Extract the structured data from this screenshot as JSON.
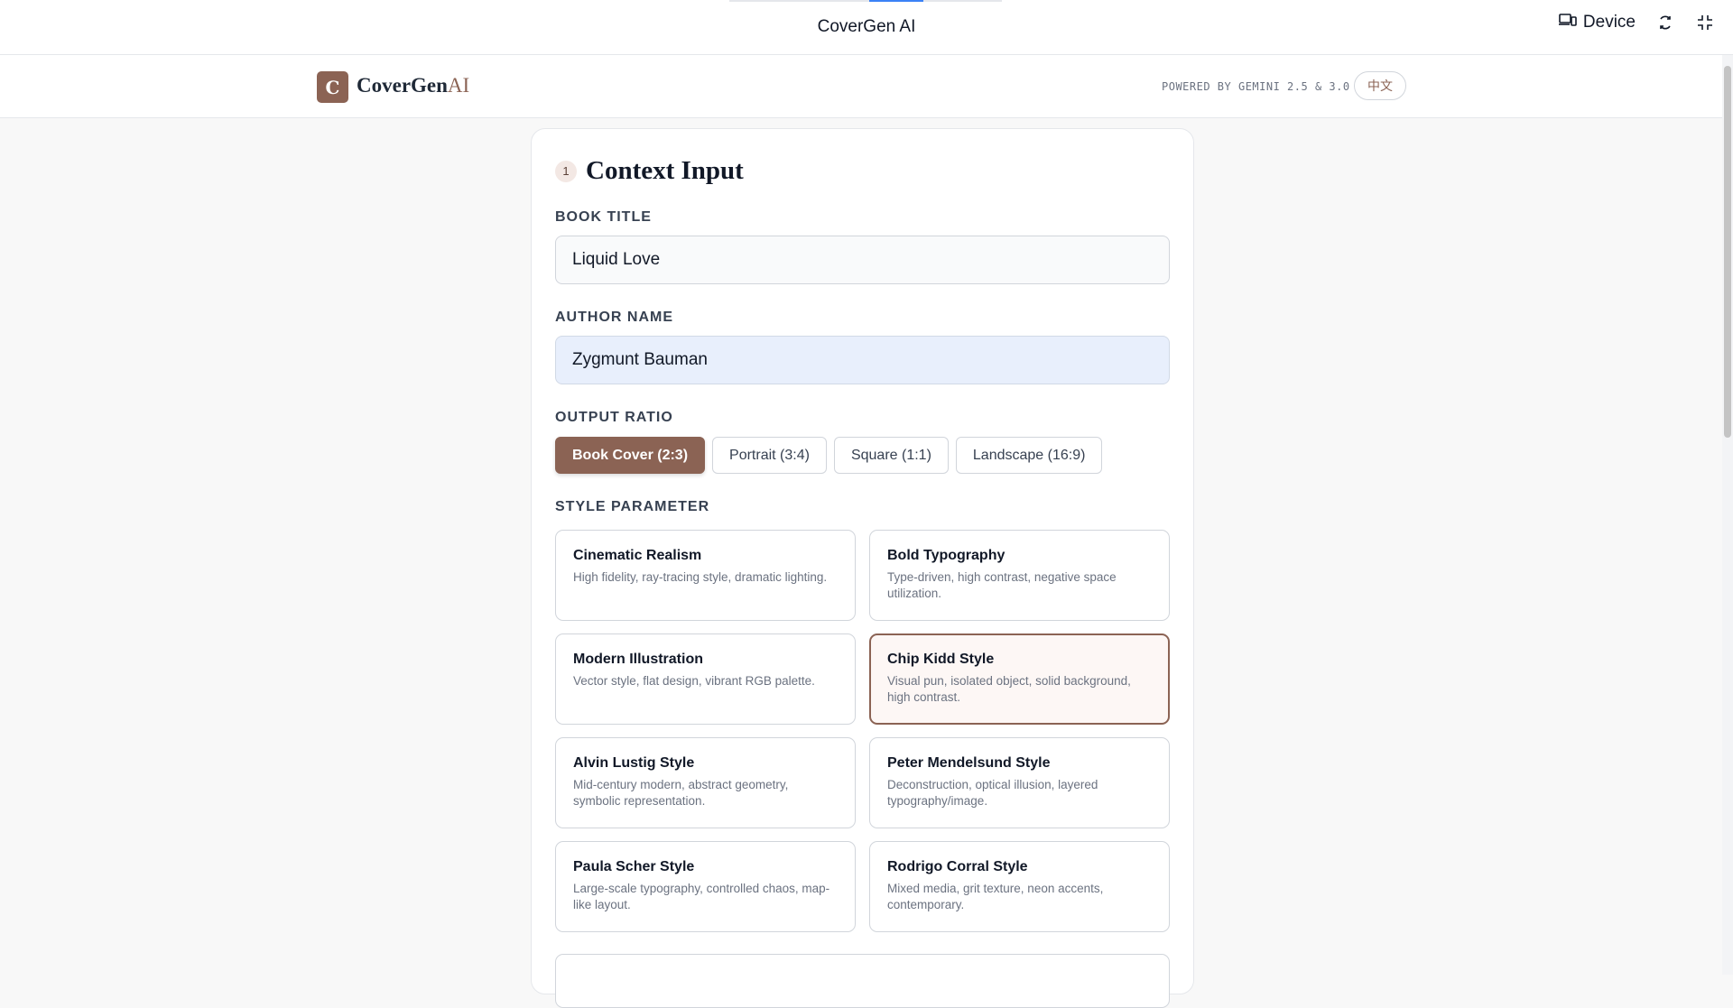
{
  "window": {
    "title": "CoverGen AI",
    "device_label": "Device"
  },
  "header": {
    "logo_letter": "C",
    "brand_main": "CoverGen",
    "brand_accent": "AI",
    "powered_by": "POWERED BY GEMINI 2.5 & 3.0",
    "language_button": "中文"
  },
  "section": {
    "step": "1",
    "title": "Context Input"
  },
  "fields": {
    "book_title_label": "BOOK TITLE",
    "book_title_value": "Liquid Love",
    "author_label": "AUTHOR NAME",
    "author_value": "Zygmunt Bauman"
  },
  "ratio": {
    "label": "OUTPUT RATIO",
    "selected": "Book Cover (2:3)",
    "options": [
      "Book Cover (2:3)",
      "Portrait (3:4)",
      "Square (1:1)",
      "Landscape (16:9)"
    ]
  },
  "styles": {
    "label": "STYLE PARAMETER",
    "selected": "Chip Kidd Style",
    "items": [
      {
        "name": "Cinematic Realism",
        "desc": "High fidelity, ray-tracing style, dramatic lighting."
      },
      {
        "name": "Bold Typography",
        "desc": "Type-driven, high contrast, negative space utilization."
      },
      {
        "name": "Modern Illustration",
        "desc": "Vector style, flat design, vibrant RGB palette."
      },
      {
        "name": "Chip Kidd Style",
        "desc": "Visual pun, isolated object, solid background, high contrast."
      },
      {
        "name": "Alvin Lustig Style",
        "desc": "Mid-century modern, abstract geometry, symbolic representation."
      },
      {
        "name": "Peter Mendelsund Style",
        "desc": "Deconstruction, optical illusion, layered typography/image."
      },
      {
        "name": "Paula Scher Style",
        "desc": "Large-scale typography, controlled chaos, map-like layout."
      },
      {
        "name": "Rodrigo Corral Style",
        "desc": "Mixed media, grit texture, neon accents, contemporary."
      }
    ]
  },
  "colors": {
    "accent": "#8b6354",
    "selected_card_bg": "#fdf7f5",
    "autofill_bg": "#e8effc"
  }
}
